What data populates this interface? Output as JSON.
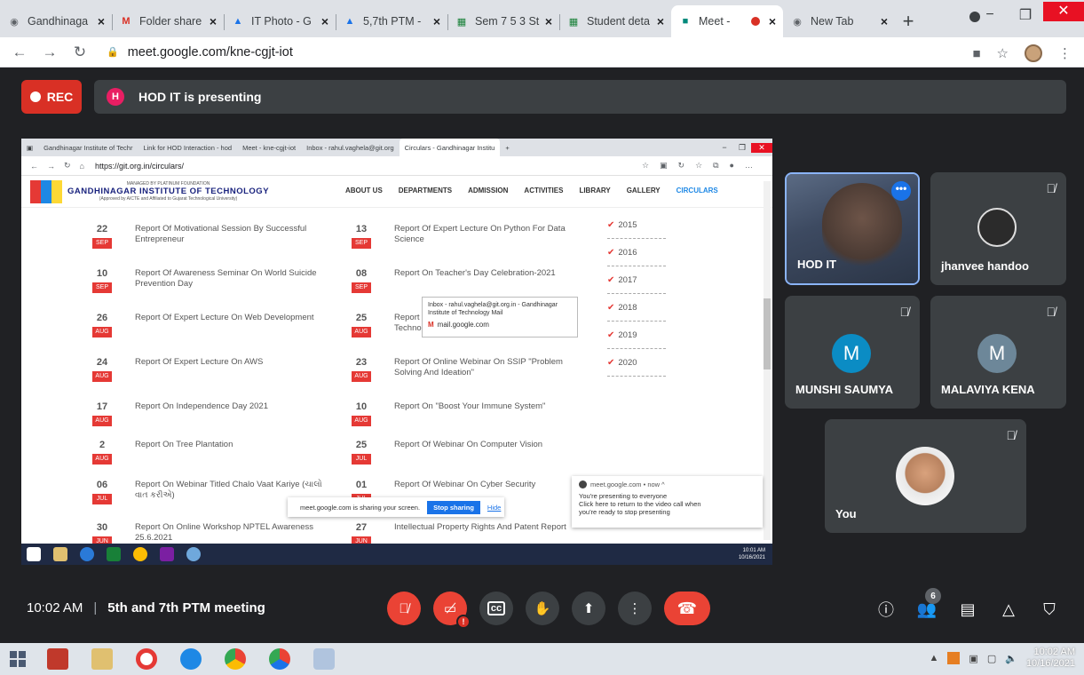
{
  "browser": {
    "tabs": [
      {
        "title": "Gandhinaga",
        "favicon": "chrome-icon",
        "color": "#5f6368",
        "active": false
      },
      {
        "title": "Folder share",
        "favicon": "gmail-icon",
        "color": "#d93025",
        "active": false
      },
      {
        "title": "IT Photo - G",
        "favicon": "drive-icon",
        "color": "#1a73e8",
        "active": false
      },
      {
        "title": "5,7th PTM -",
        "favicon": "drive-icon",
        "color": "#1a73e8",
        "active": false
      },
      {
        "title": "Sem 7 5 3 St",
        "favicon": "sheets-icon",
        "color": "#188038",
        "active": false
      },
      {
        "title": "Student deta",
        "favicon": "sheets-icon",
        "color": "#188038",
        "active": false
      },
      {
        "title": "Meet - ",
        "favicon": "meet-icon",
        "color": "#00897b",
        "active": true,
        "recording": true
      },
      {
        "title": "New Tab",
        "favicon": "chrome-icon",
        "color": "#5f6368",
        "active": false
      }
    ],
    "url": "meet.google.com/kne-cgjt-iot"
  },
  "meet": {
    "rec_label": "REC",
    "presenter_initial": "H",
    "presenting_text": "HOD IT is presenting",
    "time": "10:02 AM",
    "meeting_name": "5th and 7th PTM meeting",
    "participant_count": "6",
    "participants": [
      {
        "name": "HOD IT",
        "type": "video"
      },
      {
        "name": "jhanvee handoo",
        "type": "photo"
      },
      {
        "name": "MUNSHI SAUMYA",
        "initial": "M",
        "color": "#0b8cc4"
      },
      {
        "name": "MALAVIYA KENA",
        "initial": "M",
        "color": "#6d8799"
      },
      {
        "name": "You",
        "type": "photo"
      }
    ]
  },
  "shared": {
    "tabs": [
      "Gandhinagar Institute of Techr",
      "Link for HOD Interaction - hod",
      "Meet - kne-cgjt-iot",
      "Inbox - rahul.vaghela@git.org",
      "Circulars - Gandhinagar Institu"
    ],
    "url": "https://git.org.in/circulars/",
    "tooltip_line1": "Inbox - rahul.vaghela@git.org.in - Gandhinagar",
    "tooltip_line2": "Institute of Technology Mail",
    "tooltip_mail": "mail.google.com",
    "site_small_top": "MANAGED BY PLATINUM FOUNDATION",
    "site_name": "GANDHINAGAR INSTITUTE OF TECHNOLOGY",
    "site_small_bottom": "(Approved by AICTE and Affiliated to Gujarat Technological University)",
    "nav": [
      "ABOUT US",
      "DEPARTMENTS",
      "ADMISSION",
      "ACTIVITIES",
      "LIBRARY",
      "GALLERY",
      "CIRCULARS"
    ],
    "left_entries": [
      {
        "day": "22",
        "mon": "SEP",
        "text": "Report Of Motivational Session By Successful Entrepreneur"
      },
      {
        "day": "10",
        "mon": "SEP",
        "text": "Report Of Awareness Seminar On World Suicide Prevention Day"
      },
      {
        "day": "26",
        "mon": "AUG",
        "text": "Report Of Expert Lecture On Web Development"
      },
      {
        "day": "24",
        "mon": "AUG",
        "text": "Report Of Expert Lecture On AWS"
      },
      {
        "day": "17",
        "mon": "AUG",
        "text": "Report On Independence Day 2021"
      },
      {
        "day": "2",
        "mon": "AUG",
        "text": "Report On Tree Plantation"
      },
      {
        "day": "06",
        "mon": "JUL",
        "text": "Report On Webinar Titled Chalo Vaat Kariye (ચાલો વાત કરીએ)"
      },
      {
        "day": "30",
        "mon": "JUN",
        "text": "Report On Online Workshop NPTEL Awareness 25.6.2021"
      }
    ],
    "right_entries": [
      {
        "day": "13",
        "mon": "SEP",
        "text": "Report Of Expert Lecture On Python For Data Science"
      },
      {
        "day": "08",
        "mon": "SEP",
        "text": "Report On Teacher's Day Celebration-2021"
      },
      {
        "day": "25",
        "mon": "AUG",
        "text": "Report Of Expert Lecture On Blockchain Technology"
      },
      {
        "day": "23",
        "mon": "AUG",
        "text": "Report Of Online Webinar On SSIP \"Problem Solving And Ideation\""
      },
      {
        "day": "10",
        "mon": "AUG",
        "text": "Report On \"Boost Your Immune System\""
      },
      {
        "day": "25",
        "mon": "JUL",
        "text": "Report Of Webinar On Computer Vision"
      },
      {
        "day": "01",
        "mon": "JUL",
        "text": "Report Of Webinar On Cyber Security"
      },
      {
        "day": "27",
        "mon": "JUN",
        "text": "Intellectual Property Rights And Patent Report"
      }
    ],
    "years": [
      "2015",
      "2016",
      "2017",
      "2018",
      "2019",
      "2020"
    ],
    "notif_source": "meet.google.com • now ^",
    "notif_line1": "You're presenting to everyone",
    "notif_line2": "Click here to return to the video call when",
    "notif_line3": "you're ready to stop presenting",
    "sharing_text": "meet.google.com is sharing your screen.",
    "stop_sharing": "Stop sharing",
    "hide": "Hide",
    "clock_time": "10:01 AM",
    "clock_date": "10/16/2021"
  },
  "taskbar": {
    "time": "10:02 AM",
    "date": "10/16/2021"
  }
}
